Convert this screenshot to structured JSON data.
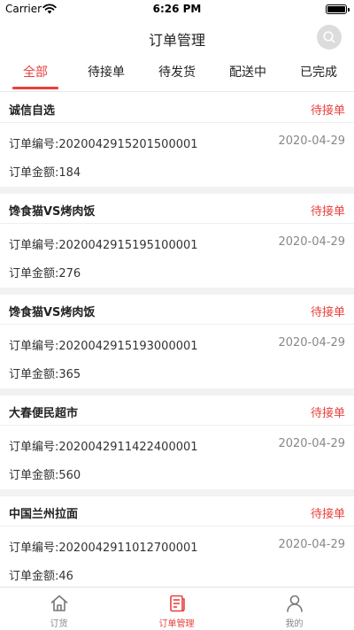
{
  "status_bar": {
    "carrier": "Carrier",
    "time": "6:26 PM"
  },
  "nav": {
    "title": "订单管理",
    "search_icon": "search-icon"
  },
  "tabs": [
    {
      "label": "全部",
      "active": true
    },
    {
      "label": "待接单",
      "active": false
    },
    {
      "label": "待发货",
      "active": false
    },
    {
      "label": "配送中",
      "active": false
    },
    {
      "label": "已完成",
      "active": false
    }
  ],
  "orders": [
    {
      "shop": "诚信自选",
      "status": "待接单",
      "order_no": "订单编号:2020042915201500001",
      "date": "2020-04-29",
      "amount": "订单金额:184"
    },
    {
      "shop": "馋食猫VS烤肉饭",
      "status": "待接单",
      "order_no": "订单编号:2020042915195100001",
      "date": "2020-04-29",
      "amount": "订单金额:276"
    },
    {
      "shop": "馋食猫VS烤肉饭",
      "status": "待接单",
      "order_no": "订单编号:2020042915193000001",
      "date": "2020-04-29",
      "amount": "订单金额:365"
    },
    {
      "shop": "大春便民超市",
      "status": "待接单",
      "order_no": "订单编号:2020042911422400001",
      "date": "2020-04-29",
      "amount": "订单金额:560"
    },
    {
      "shop": "中国兰州拉面",
      "status": "待接单",
      "order_no": "订单编号:2020042911012700001",
      "date": "2020-04-29",
      "amount": "订单金额:46"
    }
  ],
  "tab_bar": [
    {
      "label": "订货",
      "icon": "home-icon",
      "active": false
    },
    {
      "label": "订单管理",
      "icon": "order-list-icon",
      "active": true
    },
    {
      "label": "我的",
      "icon": "user-icon",
      "active": false
    }
  ],
  "colors": {
    "accent": "#e8413c",
    "background": "#f2f2f2"
  }
}
